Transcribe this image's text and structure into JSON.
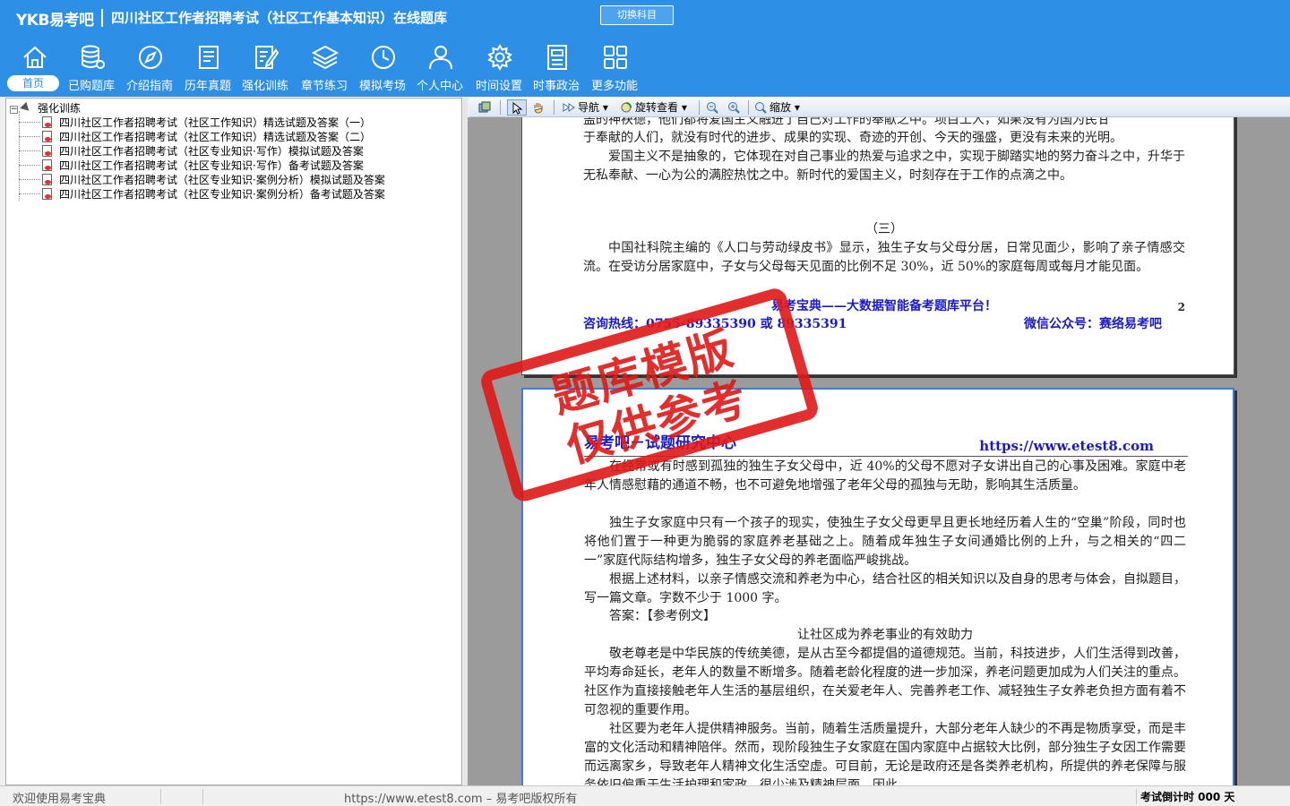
{
  "app": {
    "logo": "YKB易考吧",
    "title": "四川社区工作者招聘考试（社区工作基本知识）在线题库",
    "switch_subject": "切换科目"
  },
  "nav": [
    {
      "label": "首页",
      "icon": "home-icon"
    },
    {
      "label": "已购题库",
      "icon": "database-icon"
    },
    {
      "label": "介绍指南",
      "icon": "compass-icon"
    },
    {
      "label": "历年真题",
      "icon": "document-list-icon"
    },
    {
      "label": "强化训练",
      "icon": "edit-document-icon"
    },
    {
      "label": "章节练习",
      "icon": "layers-icon"
    },
    {
      "label": "模拟考场",
      "icon": "clock-icon"
    },
    {
      "label": "个人中心",
      "icon": "user-icon"
    },
    {
      "label": "时间设置",
      "icon": "gear-icon"
    },
    {
      "label": "时事政治",
      "icon": "news-icon"
    },
    {
      "label": "更多功能",
      "icon": "grid-icon"
    }
  ],
  "tree": {
    "root": "强化训练",
    "items": [
      "四川社区工作者招聘考试（社区工作知识）精选试题及答案（一）",
      "四川社区工作者招聘考试（社区工作知识）精选试题及答案（二）",
      "四川社区工作者招聘考试（社区专业知识·写作）模拟试题及答案",
      "四川社区工作者招聘考试（社区专业知识·写作）备考试题及答案",
      "四川社区工作者招聘考试（社区专业知识·案例分析）模拟试题及答案",
      "四川社区工作者招聘考试（社区专业知识·案例分析）备考试题及答案"
    ]
  },
  "viewer_toolbar": {
    "nav": "导航",
    "rotate": "旋转查看",
    "zoom": "缩放"
  },
  "page1": {
    "line0": "盖的神袂德，他们都将爱国主义融进了自己对工作的奉献之中。项目工人，如果没有为国为民甘",
    "line1": "于奉献的人们，就没有时代的进步、成果的实现、奇迹的开创、今天的强盛，更没有未来的光明。",
    "para1": "爱国主义不是抽象的，它体现在对自己事业的热爱与追求之中，实现于脚踏实地的努力奋斗之中，升华于无私奉献、一心为公的满腔热忱之中。新时代的爱国主义，时刻存在于工作的点滴之中。",
    "section": "（三）",
    "para2": "中国社科院主编的《人口与劳动绿皮书》显示，独生子女与父母分居，日常见面少，影响了亲子情感交流。在受访分居家庭中，子女与父母每天见面的比例不足 30%，近 50%的家庭每周或每月才能见面。",
    "footer_slogan": "易考宝典——大数据智能备考题库平台！",
    "page_number": "2",
    "hotline": "咨询热线：0755-89335390 或 89335391",
    "wechat": "微信公众号：赛络易考吧"
  },
  "page2": {
    "header_left": "易考吧－试题研究中心",
    "header_right": "https://www.etest8.com",
    "para1": "在经常或有时感到孤独的独生子女父母中，近 40%的父母不愿对子女讲出自己的心事及困难。家庭中老年人情感慰藉的通道不畅，也不可避免地增强了老年父母的孤独与无助，影响其生活质量。",
    "para2": "独生子女家庭中只有一个孩子的现实，使独生子女父母更早且更长地经历着人生的“空巢”阶段，同时也将他们置于一种更为脆弱的家庭养老基础之上。随着成年独生子女间通婚比例的上升，与之相关的“四二一”家庭代际结构增多，独生子女父母的养老面临严峻挑战。",
    "para3": "根据上述材料，以亲子情感交流和养老为中心，结合社区的相关知识以及自身的思考与体会，自拟题目，写一篇文章。字数不少于 1000 字。",
    "answer": "答案：【参考例文】",
    "essay_title": "让社区成为养老事业的有效助力",
    "para4": "敬老尊老是中华民族的传统美德，是从古至今都提倡的道德规范。当前，科技进步，人们生活得到改善，平均寿命延长，老年人的数量不断增多。随着老龄化程度的进一步加深，养老问题更加成为人们关注的重点。社区作为直接接触老年人生活的基层组织，在关爱老年人、完善养老工作、减轻独生子女养老负担方面有着不可忽视的重要作用。",
    "para5": "社区要为老年人提供精神服务。当前，随着生活质量提升，大部分老年人缺少的不再是物质享受，而是丰富的文化活动和精神陪伴。然而，现阶段独生子女家庭在国内家庭中占据较大比例，部分独生子女因工作需要而远离家乡，导致老年人精神文化生活空虚。可目前，无论是政府还是各类养老机构，所提供的养老保障与服务依旧偏重于生活护理和家政，很少涉及精神层面。因此，"
  },
  "stamp": {
    "line1": "题库模版",
    "line2": "仅供参考"
  },
  "status": {
    "welcome": "欢迎使用易考宝典",
    "copyright": "https://www.etest8.com – 易考吧版权所有",
    "countdown": "考试倒计时 000 天"
  },
  "colors": {
    "header_bg": "#2e8fe6",
    "stamp_red": "#e01818",
    "link_blue": "#1a1acf"
  }
}
